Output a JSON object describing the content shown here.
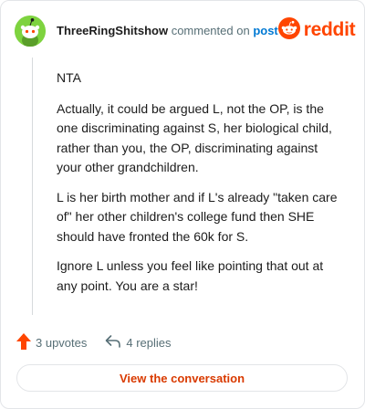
{
  "header": {
    "username": "ThreeRingShitshow",
    "action_text": "commented on",
    "post_link": "post",
    "brand": "reddit"
  },
  "comment": {
    "paragraphs": [
      "NTA",
      "Actually, it could be argued L, not the OP, is the one discriminating against S, her biological child, rather than you, the OP, discriminating against your other grandchildren.",
      "L is her birth mother and if L's already \"taken care of\" her other children's college fund then SHE should have fronted the 60k for S.",
      "Ignore L unless you feel like pointing that out at any point. You are a star!"
    ]
  },
  "actions": {
    "upvotes": "3 upvotes",
    "replies": "4 replies"
  },
  "cta": {
    "label": "View the conversation"
  },
  "colors": {
    "accent": "#ff4500",
    "link": "#0079d3",
    "cta_text": "#d93a00",
    "avatar_bg": "#7ed33f"
  },
  "icons": {
    "avatar": "snoo-avatar-icon",
    "brand": "reddit-logo-icon",
    "upvote": "upvote-arrow-icon",
    "reply": "reply-arrow-icon"
  }
}
